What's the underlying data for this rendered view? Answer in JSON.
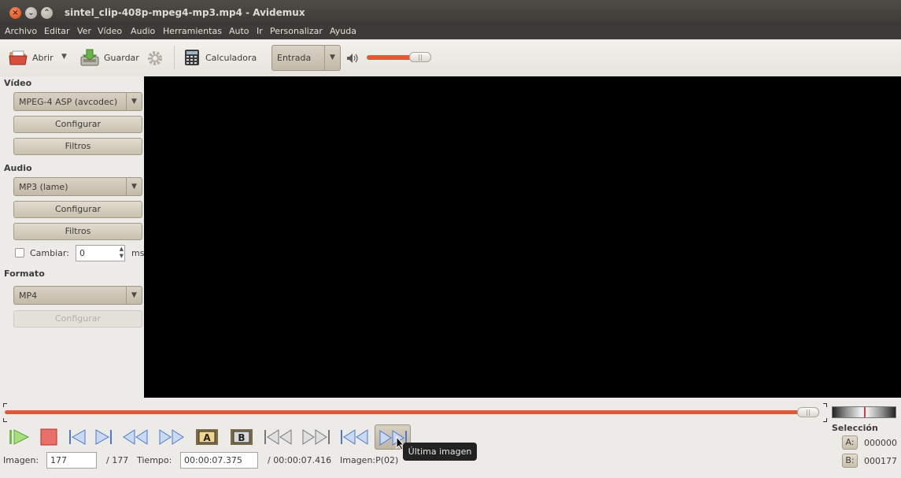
{
  "window": {
    "title": "sintel_clip-408p-mpeg4-mp3.mp4 - Avidemux"
  },
  "menu": [
    "Archivo",
    "Editar",
    "Ver",
    "Vídeo",
    "Audio",
    "Herramientas",
    "Auto",
    "Ir",
    "Personalizar",
    "Ayuda"
  ],
  "toolbar": {
    "open_label": "Abrir",
    "save_label": "Guardar",
    "calculator_label": "Calculadora",
    "input_combo": "Entrada",
    "volume_fraction": 0.82
  },
  "sidebar": {
    "video": {
      "heading": "Vídeo",
      "codec": "MPEG-4 ASP (avcodec)",
      "configure": "Configurar",
      "filters": "Filtros"
    },
    "audio": {
      "heading": "Audio",
      "codec": "MP3 (lame)",
      "configure": "Configurar",
      "filters": "Filtros",
      "shift_label": "Cambiar:",
      "shift_value": "0",
      "shift_unit": "ms"
    },
    "format": {
      "heading": "Formato",
      "container": "MP4",
      "configure": "Configurar"
    }
  },
  "timeline": {
    "position_fraction": 1.0
  },
  "status": {
    "frame_label": "Imagen:",
    "frame_value": "177",
    "frame_total": "/ 177",
    "time_label": "Tiempo:",
    "time_value": "00:00:07.375",
    "time_total": "/ 00:00:07.416",
    "frame_type": "Imagen:P(02)"
  },
  "tooltip": "Última imagen",
  "selection": {
    "heading": "Selección",
    "a_label": "A:",
    "a_value": "000000",
    "b_label": "B:",
    "b_value": "000177"
  },
  "colors": {
    "accent": "#e05a3a",
    "play": "#6ec046",
    "stop": "#d6403a",
    "nav": "#4f78c8"
  }
}
